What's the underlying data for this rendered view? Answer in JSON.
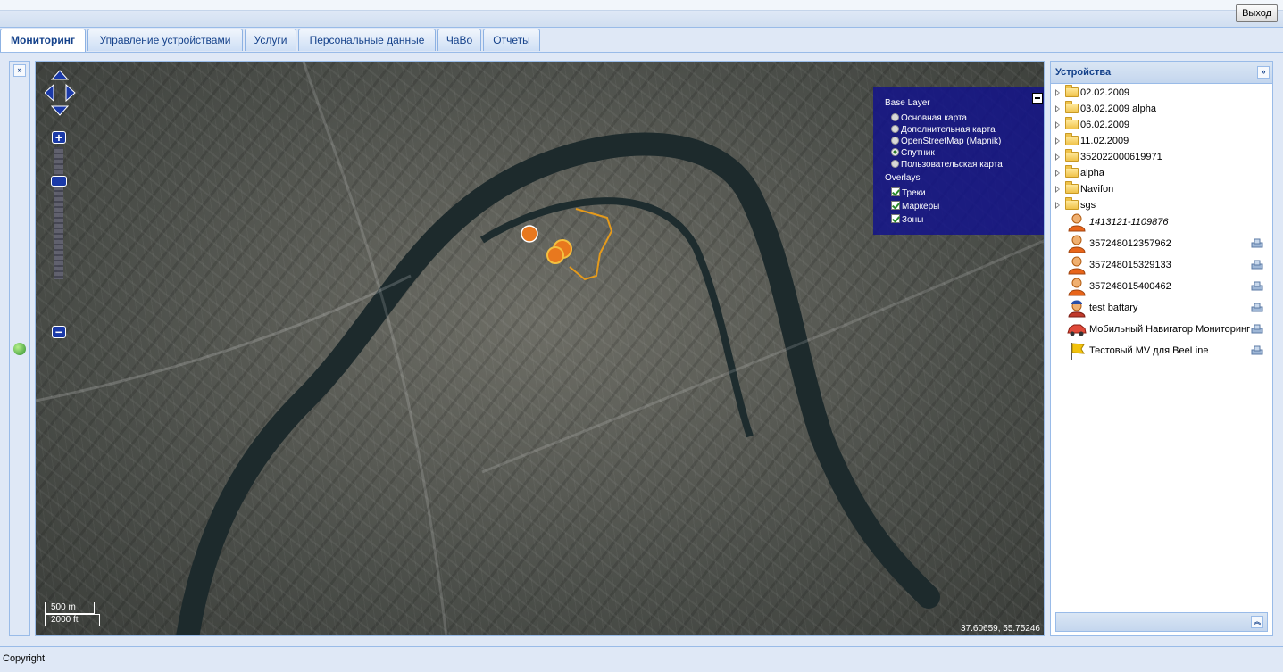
{
  "header": {
    "logout_label": "Выход"
  },
  "tabs": [
    {
      "label": "Мониторинг",
      "active": true
    },
    {
      "label": "Управление устройствами",
      "active": false
    },
    {
      "label": "Услуги",
      "active": false
    },
    {
      "label": "Персональные данные",
      "active": false
    },
    {
      "label": "ЧаВо",
      "active": false
    },
    {
      "label": "Отчеты",
      "active": false
    }
  ],
  "map": {
    "layer_switcher": {
      "base_title": "Base Layer",
      "base_layers": [
        "Основная карта",
        "Дополнительная карта",
        "OpenStreetMap (Mapnik)",
        "Спутник",
        "Пользовательская карта"
      ],
      "selected_base": "Спутник",
      "overlays_title": "Overlays",
      "overlays": [
        "Треки",
        "Маркеры",
        "Зоны"
      ]
    },
    "scale_top": "500 m",
    "scale_bottom": "2000 ft",
    "coordinates": "37.60659, 55.75246"
  },
  "devices_panel": {
    "title": "Устройства",
    "folders": [
      "02.02.2009",
      "03.02.2009 alpha",
      "06.02.2009",
      "11.02.2009",
      "352022000619971",
      "alpha",
      "Navifon",
      "sgs"
    ],
    "devices": [
      {
        "label": "1413121-1109876",
        "icon": "person-icon",
        "italic": true,
        "settings": false
      },
      {
        "label": "357248012357962",
        "icon": "person-icon",
        "italic": false,
        "settings": true
      },
      {
        "label": "357248015329133",
        "icon": "person-icon",
        "italic": false,
        "settings": true
      },
      {
        "label": "357248015400462",
        "icon": "person-icon",
        "italic": false,
        "settings": true
      },
      {
        "label": "test battary",
        "icon": "person-helmet-icon",
        "italic": false,
        "settings": true
      },
      {
        "label": "Мобильный Навигатор Мониторинг",
        "icon": "car-icon",
        "italic": false,
        "settings": true
      },
      {
        "label": "Тестовый MV для BeeLine",
        "icon": "flag-icon",
        "italic": false,
        "settings": true
      }
    ]
  },
  "footer": {
    "copyright": "Copyright"
  }
}
